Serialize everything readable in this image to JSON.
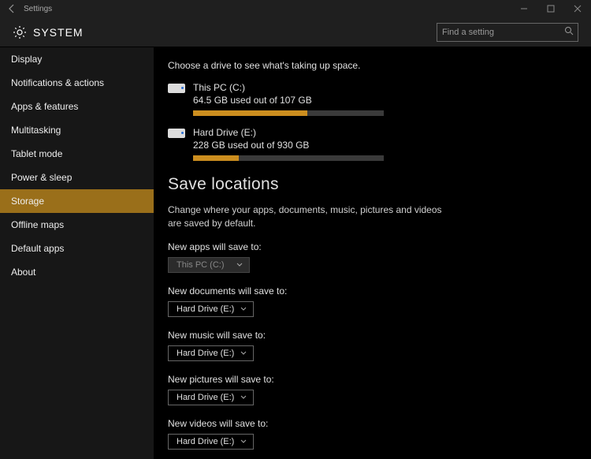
{
  "titlebar": {
    "label": "Settings"
  },
  "header": {
    "title": "SYSTEM",
    "search_placeholder": "Find a setting"
  },
  "sidebar": {
    "items": [
      {
        "label": "Display"
      },
      {
        "label": "Notifications & actions"
      },
      {
        "label": "Apps & features"
      },
      {
        "label": "Multitasking"
      },
      {
        "label": "Tablet mode"
      },
      {
        "label": "Power & sleep"
      },
      {
        "label": "Storage",
        "selected": true
      },
      {
        "label": "Offline maps"
      },
      {
        "label": "Default apps"
      },
      {
        "label": "About"
      }
    ]
  },
  "content": {
    "choose_drive_desc": "Choose a drive to see what's taking up space.",
    "drives": [
      {
        "name": "This PC (C:)",
        "usage": "64.5 GB used out of 107 GB",
        "percent": 60
      },
      {
        "name": "Hard Drive (E:)",
        "usage": "228 GB used out of 930 GB",
        "percent": 24
      }
    ],
    "save_locations": {
      "title": "Save locations",
      "desc": "Change where your apps, documents, music, pictures and videos are saved by default.",
      "groups": [
        {
          "label": "New apps will save to:",
          "value": "This PC (C:)",
          "disabled": true
        },
        {
          "label": "New documents will save to:",
          "value": "Hard Drive (E:)"
        },
        {
          "label": "New music will save to:",
          "value": "Hard Drive (E:)"
        },
        {
          "label": "New pictures will save to:",
          "value": "Hard Drive (E:)"
        },
        {
          "label": "New videos will save to:",
          "value": "Hard Drive (E:)"
        }
      ]
    }
  }
}
